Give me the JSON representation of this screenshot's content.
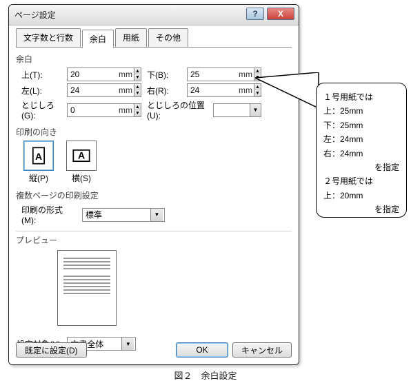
{
  "dialog": {
    "title": "ページ設定",
    "help": "?",
    "close": "X",
    "tabs": [
      "文字数と行数",
      "余白",
      "用紙",
      "その他"
    ],
    "active_tab": "余白"
  },
  "margins": {
    "group_label": "余白",
    "top_label": "上(T):",
    "top_value": "20",
    "unit": "mm",
    "bottom_label": "下(B):",
    "bottom_value": "25",
    "left_label": "左(L):",
    "left_value": "24",
    "right_label": "右(R):",
    "right_value": "24",
    "gutter_label": "とじしろ(G):",
    "gutter_value": "0",
    "gutter_pos_label": "とじしろの位置(U):"
  },
  "orientation": {
    "group_label": "印刷の向き",
    "portrait": "縦(P)",
    "landscape": "横(S)"
  },
  "multipage": {
    "group_label": "複数ページの印刷設定",
    "format_label": "印刷の形式(M):",
    "format_value": "標準"
  },
  "preview": {
    "label": "プレビュー"
  },
  "apply_to": {
    "label": "設定対象(Y):",
    "value": "文書全体"
  },
  "buttons": {
    "default": "既定に設定(D)",
    "ok": "OK",
    "cancel": "キャンセル"
  },
  "callout": {
    "line1": "１号用紙では",
    "line2": "上：25mm",
    "line3": "下：25mm",
    "line4": "左：24mm",
    "line5": "右：24mm",
    "line6": "を指定",
    "line7": "２号用紙では",
    "line8": "上：20mm",
    "line9": "を指定"
  },
  "caption": "図２　余白設定"
}
